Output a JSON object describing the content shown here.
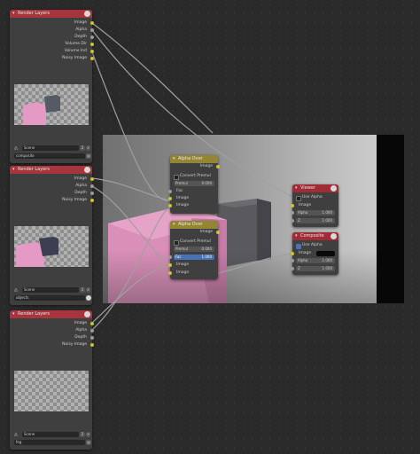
{
  "render_layers_nodes": [
    {
      "title": "Render Layers",
      "outputs": [
        "Image",
        "Alpha",
        "Depth",
        "Volume Dir",
        "Volume Ind",
        "Noisy Image"
      ],
      "scene": "Scene",
      "scene_num": "2",
      "layer": "composite"
    },
    {
      "title": "Render Layers",
      "outputs": [
        "Image",
        "Alpha",
        "Depth",
        "Noisy Image"
      ],
      "scene": "Scene",
      "scene_num": "1",
      "layer": "objects"
    },
    {
      "title": "Render Layers",
      "outputs": [
        "Image",
        "Alpha",
        "Depth",
        "Noisy Image"
      ],
      "scene": "Scene",
      "scene_num": "2",
      "layer": "fog"
    }
  ],
  "alpha_over_nodes": [
    {
      "title": "Alpha Over",
      "output": "Image",
      "convert_label": "Convert Premul",
      "premul_label": "Premul",
      "premul_value": "0.000",
      "inputs": [
        "Fac",
        "Image",
        "Image"
      ]
    },
    {
      "title": "Alpha Over",
      "output": "Image",
      "convert_label": "Convert Premul",
      "premul_label": "Premul",
      "premul_value": "0.000",
      "fac_label": "Fac",
      "fac_value": "1.000",
      "inputs": [
        "Image",
        "Image"
      ]
    }
  ],
  "viewer": {
    "title": "Viewer",
    "use_alpha": "Use Alpha",
    "inputs": [
      "Image"
    ],
    "alpha_label": "Alpha",
    "alpha_value": "1.000",
    "z_label": "Z",
    "z_value": "1.000"
  },
  "composite": {
    "title": "Composite",
    "use_alpha": "Use Alpha",
    "image_label": "Image",
    "alpha_label": "Alpha",
    "alpha_value": "1.000",
    "z_label": "Z",
    "z_value": "1.000"
  },
  "colors": {
    "render_layers_header": "#a8343d",
    "alpha_over_header": "#938533",
    "output_header": "#a02d36",
    "socket_color": "#c9c52f",
    "socket_value": "#9a9a9a",
    "socket_vector": "#6565c6",
    "wire": "#9a9a9a"
  }
}
